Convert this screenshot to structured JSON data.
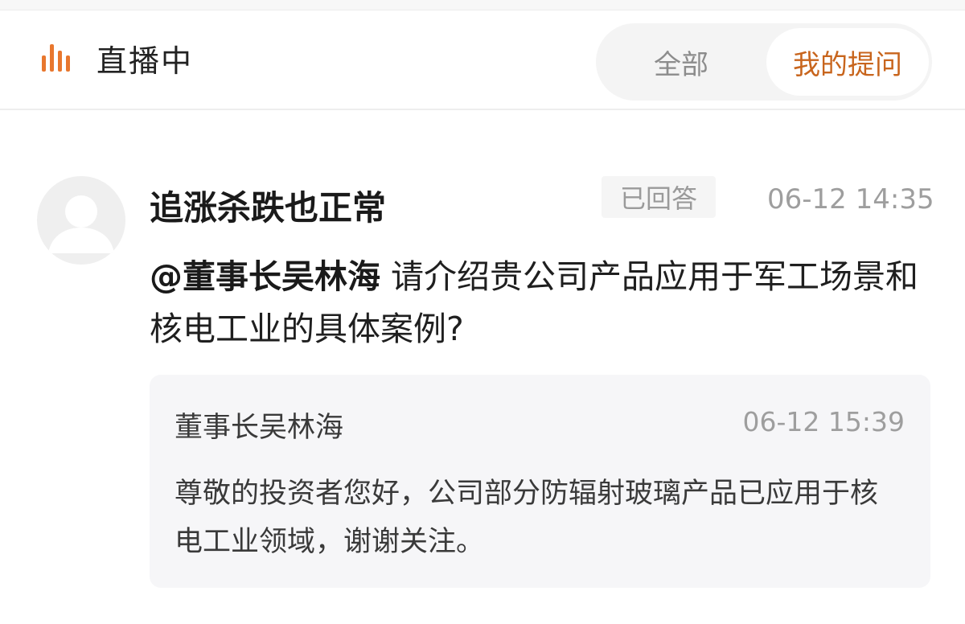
{
  "header": {
    "live_label": "直播中",
    "live_icon": "live-bars-icon",
    "tabs": [
      {
        "label": "全部",
        "active": false
      },
      {
        "label": "我的提问",
        "active": true
      }
    ]
  },
  "question": {
    "avatar_icon": "default-avatar-icon",
    "username": "追涨杀跌也正常",
    "status": "已回答",
    "time": "06-12 14:35",
    "mention": "@董事长吴林海",
    "text": "请介绍贵公司产品应用于军工场景和核电工业的具体案例?"
  },
  "answer": {
    "author": "董事长吴林海",
    "time": "06-12 15:39",
    "text": "尊敬的投资者您好，公司部分防辐射玻璃产品已应用于核电工业领域，谢谢关注。"
  },
  "colors": {
    "accent": "#c8651d",
    "live_icon": "#e8772e"
  }
}
